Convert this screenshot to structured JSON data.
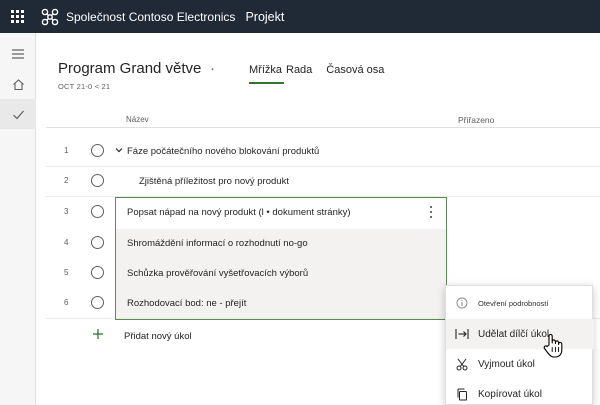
{
  "topbar": {
    "org_name": "Společnost Contoso Electronics",
    "app_name": "Projekt"
  },
  "icons": {
    "waffle": "waffle-icon",
    "brand": "network-logo-icon",
    "menu": "hamburger-icon",
    "home": "home-icon",
    "check": "checkmark-icon"
  },
  "plan": {
    "title": "Program Grand větve",
    "title_menu": "·",
    "subtitle": "OCT 21-0 < 21",
    "tabs": [
      {
        "label": "Mřížka",
        "active": true
      },
      {
        "label": "Rada",
        "active": false
      },
      {
        "label": "Časová osa",
        "active": false
      }
    ]
  },
  "columns": {
    "name": "Název",
    "assigned": "Přiřazeno"
  },
  "rows": [
    {
      "num": "1",
      "title": "Fáze počátečního nového blokování produktů"
    },
    {
      "num": "2",
      "title": "Zjištěná příležitost pro nový produkt"
    },
    {
      "num": "3",
      "title": "Popsat nápad na nový produkt (l • dokument stránky)"
    },
    {
      "num": "4",
      "title": "Shromáždění informací o rozhodnutí no-go"
    },
    {
      "num": "5",
      "title": "Schůzka prověřování vyšetřovacích výborů"
    },
    {
      "num": "6",
      "title": "Rozhodovací bod: ne - přejít"
    }
  ],
  "add_task": "Přidat nový úkol",
  "context_menu": {
    "items": [
      {
        "label": "Otevření podrobností",
        "icon": "info-icon"
      },
      {
        "label": "Udělat dílčí úkol",
        "icon": "indent-icon"
      },
      {
        "label": "Vyjmout úkol",
        "icon": "scissors-icon"
      },
      {
        "label": "Kopírovat úkol",
        "icon": "copy-icon"
      }
    ]
  },
  "colors": {
    "topbar": "#1f2a36",
    "accent": "#31752f",
    "selection_border": "#5b8a53"
  }
}
